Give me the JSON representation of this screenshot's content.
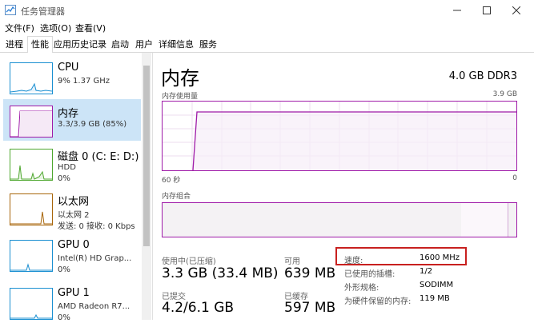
{
  "window": {
    "title": "任务管理器"
  },
  "menu": [
    "文件(F)",
    "选项(O)",
    "查看(V)"
  ],
  "tabs": [
    "进程",
    "性能",
    "应用历史记录",
    "启动",
    "用户",
    "详细信息",
    "服务"
  ],
  "sidebar": {
    "items": [
      {
        "title": "CPU",
        "line1": "9% 1.37 GHz",
        "line2": ""
      },
      {
        "title": "内存",
        "line1": "3.3/3.9 GB (85%)",
        "line2": ""
      },
      {
        "title": "磁盘 0 (C: E: D:)",
        "line1": "HDD",
        "line2": "0%"
      },
      {
        "title": "以太网",
        "line1": "以太网 2",
        "line2": "发送: 0 接收: 0 Kbps"
      },
      {
        "title": "GPU 0",
        "line1": "Intel(R) HD Grap...",
        "line2": "0%"
      },
      {
        "title": "GPU 1",
        "line1": "AMD Radeon R7...",
        "line2": "0%"
      }
    ]
  },
  "main": {
    "title": "内存",
    "spec": "4.0 GB DDR3",
    "usage_label": "内存使用量",
    "usage_max": "3.9 GB",
    "time_left": "60 秒",
    "time_right": "0",
    "composition_label": "内存组合",
    "stats": {
      "in_use_label": "使用中(已压缩)",
      "in_use_value": "3.3 GB (33.4 MB)",
      "available_label": "可用",
      "available_value": "639 MB",
      "committed_label": "已提交",
      "committed_value": "4.2/6.1 GB",
      "cached_label": "已缓存",
      "cached_value": "597 MB"
    },
    "props": [
      {
        "key": "速度:",
        "value": "1600 MHz"
      },
      {
        "key": "已使用的插槽:",
        "value": "1/2"
      },
      {
        "key": "外形规格:",
        "value": "SODIMM"
      },
      {
        "key": "为硬件保留的内存:",
        "value": "119 MB"
      }
    ]
  },
  "colors": {
    "memory_accent": "#9f1aa8",
    "cpu_accent": "#1a8fd1",
    "disk_accent": "#4ea72e",
    "eth_accent": "#a8660b",
    "highlight": "#c8201f"
  }
}
